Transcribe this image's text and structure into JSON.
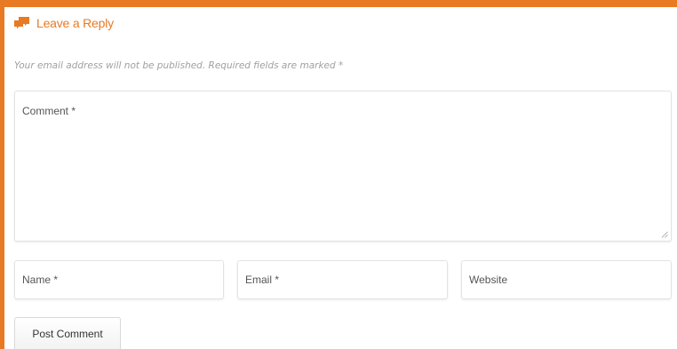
{
  "colors": {
    "accent": "#e87a24",
    "notes_text": "#a0a0a0",
    "field_border": "#e3e3e3"
  },
  "header": {
    "icon": "comments-icon",
    "title": "Leave a Reply"
  },
  "notes": {
    "text": "Your email address will not be published. Required fields are marked *"
  },
  "form": {
    "comment": {
      "placeholder": "Comment *",
      "value": ""
    },
    "name": {
      "placeholder": "Name *",
      "value": ""
    },
    "email": {
      "placeholder": "Email *",
      "value": ""
    },
    "website": {
      "placeholder": "Website",
      "value": ""
    },
    "submit_label": "Post Comment"
  }
}
